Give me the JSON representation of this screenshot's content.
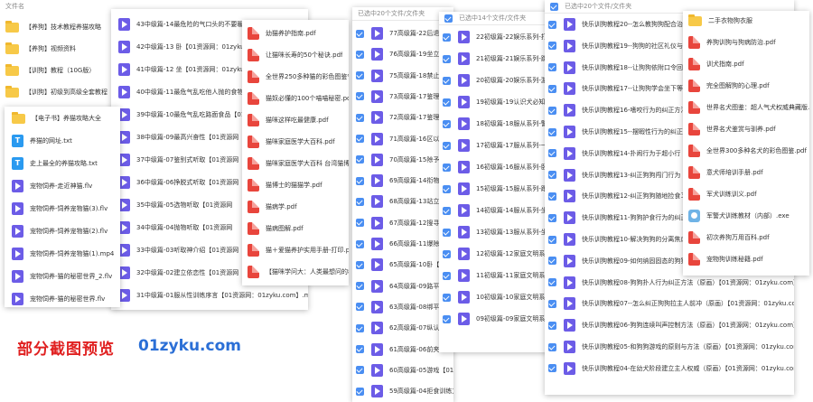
{
  "p1": {
    "header": "文件名",
    "items": [
      {
        "icon": "folder",
        "label": "【养狗】技术教程养猫攻略"
      },
      {
        "icon": "folder",
        "label": "【养狗】视频资料"
      },
      {
        "icon": "folder",
        "label": "【训狗】教程（10G版）"
      },
      {
        "icon": "folder",
        "label": "【训狗】初级到高级全套教程"
      }
    ]
  },
  "p2": {
    "items": [
      {
        "icon": "folder",
        "label": "【电子书】养猫攻略大全"
      },
      {
        "icon": "txt",
        "label": "养猫的网址.txt"
      },
      {
        "icon": "txt",
        "label": "史上最全的养猫攻略.txt"
      },
      {
        "icon": "video",
        "label": "宠物饲养-走近神猫.flv"
      },
      {
        "icon": "video",
        "label": "宠物饲养-饲养宠物猫(3).flv"
      },
      {
        "icon": "video",
        "label": "宠物饲养-饲养宠物猫(2).flv"
      },
      {
        "icon": "video",
        "label": "宠物饲养-饲养宠物猫(1).mp4"
      },
      {
        "icon": "video",
        "label": "宠物饲养-猫的秘密世界_2.flv"
      },
      {
        "icon": "video",
        "label": "宠物饲养-猫的秘密世界.flv"
      }
    ]
  },
  "p3": {
    "items": [
      {
        "icon": "video",
        "label": "43中级篇-14最危险的气口头的不要暖喂养视频"
      },
      {
        "icon": "video",
        "label": "42中级篇-13 卧【01资源网：01zyku.com】"
      },
      {
        "icon": "video",
        "label": "41中级篇-12 坐【01资源网：01zyku.com】"
      },
      {
        "icon": "video",
        "label": "40中级篇-11最危气乱吃他人抛的食物的"
      },
      {
        "icon": "video",
        "label": "39中级篇-10最危气乱吃路面食品【01资"
      },
      {
        "icon": "video",
        "label": "38中级篇-09最高兴奋性【01资源网"
      },
      {
        "icon": "video",
        "label": "37中级篇-07鉴别式听取【01资源网"
      },
      {
        "icon": "video",
        "label": "36中级篇-06挣脱式听取【01资源网"
      },
      {
        "icon": "video",
        "label": "35中级篇-05选物听取【01资源网"
      },
      {
        "icon": "video",
        "label": "34中级篇-04抛物听取【01资源网"
      },
      {
        "icon": "video",
        "label": "33中级篇-03听取神介绍【01资源网"
      },
      {
        "icon": "video",
        "label": "32中级篇-02建立依恋性【01资源网"
      },
      {
        "icon": "video",
        "label": "31中级篇-01服从性训练序言【01资源网：01zyku.com】.mpg"
      }
    ]
  },
  "p4": {
    "items": [
      {
        "icon": "pdf",
        "label": "幼猫养护指南.pdf"
      },
      {
        "icon": "pdf",
        "label": "让猫咪长寿的50个秘诀.pdf"
      },
      {
        "icon": "pdf",
        "label": "全世界250多种猫的彩色图鉴%50"
      },
      {
        "icon": "pdf",
        "label": "猫奴必懂的100个喵喵秘密.pdf"
      },
      {
        "icon": "pdf",
        "label": "猫咪这样吃最健康.pdf"
      },
      {
        "icon": "pdf",
        "label": "猫咪家庭医学大百科.pdf"
      },
      {
        "icon": "pdf",
        "label": "猫咪家庭医学大百科 台湾猫博士"
      },
      {
        "icon": "pdf",
        "label": "猫博士的猫猫学.pdf"
      },
      {
        "icon": "pdf",
        "label": "猫病学.pdf"
      },
      {
        "icon": "pdf",
        "label": "猫病图解.pdf"
      },
      {
        "icon": "pdf",
        "label": "猫＋爱猫养护实用手册-打印.pdf"
      },
      {
        "icon": "pdf",
        "label": "【猫咪学问大：人类最想问的80个"
      }
    ]
  },
  "p5": {
    "header": "已选中20个文件/文件夹",
    "items": [
      {
        "label": "77高级篇-22后退【01资"
      },
      {
        "label": "76高级篇-19坐立【01资"
      },
      {
        "label": "75高级篇-18禁止【01资"
      },
      {
        "label": "73高级篇-17鉴理性【01"
      },
      {
        "label": "72高级篇-17鉴理性训练"
      },
      {
        "label": "71高级篇-16区以与养"
      },
      {
        "label": "70高级篇-15除予持物"
      },
      {
        "label": "69高级篇-14衔物【01资"
      },
      {
        "label": "68高级篇-13站立【01资"
      },
      {
        "label": "67高级篇-12搜寻方向"
      },
      {
        "label": "66高级篇-11爆除面目"
      },
      {
        "label": "65高级篇-10卧【01资源网"
      },
      {
        "label": "64高级篇-09路平面的"
      },
      {
        "label": "63高级篇-08绑平面性"
      },
      {
        "label": "62高级篇-07纵认搜物"
      },
      {
        "label": "61高级篇-06前夹【01资源网：01zyku.com】.mpg"
      },
      {
        "label": "60高级篇-05游戏【01资源网：01zyku.com】.mpg"
      },
      {
        "label": "59高级篇-04拒食训练方法【01资源网：01zyku.com】.mpg"
      }
    ]
  },
  "p6": {
    "header": "已选中14个文件/文件夹",
    "items": [
      {
        "label": "22初级篇-22娱乐系列-打转"
      },
      {
        "label": "21初级篇-21娱乐系列-跳绳"
      },
      {
        "label": "20初级篇-20娱乐系列-游泳"
      },
      {
        "label": "19初级篇-19认识犬必知"
      },
      {
        "label": "18初级篇-18服从系列-警告"
      },
      {
        "label": "17初级篇-17服从系列-一招"
      },
      {
        "label": "16初级篇-16服从系列-卧在"
      },
      {
        "label": "15初级篇-15服从系列-跟随"
      },
      {
        "label": "14初级篇-14服从系列-坐在"
      },
      {
        "label": "13初级篇-13服从系列-坐"
      },
      {
        "label": "12初级篇-12家庭文明系列"
      },
      {
        "label": "11初级篇-11家庭文明系列"
      },
      {
        "label": "10初级篇-10家庭文明系列"
      },
      {
        "label": "09初级篇-09家庭文明系列"
      }
    ]
  },
  "p7": {
    "header": "已选中20个文件/文件夹",
    "items": [
      {
        "label": "快乐训狗教程20--怎么教狗狗配合治疗"
      },
      {
        "label": "快乐训狗教程19--狗狗的社区礼仪与最佳"
      },
      {
        "label": "快乐训狗教程18--让狗狗依附口令回到窝"
      },
      {
        "label": "快乐训狗教程17--让狗狗学会坐下等待"
      },
      {
        "label": "快乐训狗教程16-嗜咬行为的纠正方法"
      },
      {
        "label": "快乐训狗教程15--摆暇性行为的纠正方法"
      },
      {
        "label": "快乐训狗教程14-扑闹行为于超小行"
      },
      {
        "label": "快乐训狗教程13-纠正狗狗闯门行为"
      },
      {
        "label": "快乐训狗教程12-纠正狗狗随地捡食习惯"
      },
      {
        "label": "快乐训狗教程11-狗狗护食行为的纠正"
      },
      {
        "label": "快乐训狗教程10-解决狗狗的分离焦虑"
      },
      {
        "label": "快乐训狗教程09-如何纳固固态的狗狗"
      },
      {
        "label": "快乐训狗教程08-狗狗扑人行为纠正方法（原画）【01资源网：01zyku.com】.m"
      },
      {
        "label": "快乐训狗教程07--怎么纠正狗狗拉主人前冲（原画）【01资源网：01zyku.com】.m"
      },
      {
        "label": "快乐训狗教程06-狗狗连续叫声控制方法（原画）【01资源网：01zyku.com】.m"
      },
      {
        "label": "快乐训狗教程05-和狗狗游戏的原则与方法（原画）【01资源网：01zyku.com】.m"
      },
      {
        "label": "快乐训狗教程04-在幼犬阶段建立主人权威（原画）【01资源网：01zyku.com】.m"
      }
    ]
  },
  "p8": {
    "items": [
      {
        "icon": "folder",
        "label": "二手衣物狗衣服"
      },
      {
        "icon": "pdf",
        "label": "养狗训狗与狗病防治.pdf"
      },
      {
        "icon": "pdf",
        "label": "训犬指南.pdf"
      },
      {
        "icon": "pdf",
        "label": "完全图解狗的心理.pdf"
      },
      {
        "icon": "pdf",
        "label": "世界名犬图鉴：超人气犬权威典藏版.pdf"
      },
      {
        "icon": "pdf",
        "label": "世界名犬鉴赏与驯养.pdf"
      },
      {
        "icon": "pdf",
        "label": "全世界300多种名犬的彩色图鉴.pdf"
      },
      {
        "icon": "pdf",
        "label": "意犬师培训手册.pdf"
      },
      {
        "icon": "pdf",
        "label": "军犬训练训义.pdf"
      },
      {
        "icon": "exe",
        "label": "军警犬训练教材（内部）.exe"
      },
      {
        "icon": "pdf",
        "label": "初次养狗万用百科.pdf"
      },
      {
        "icon": "pdf",
        "label": "宠物狗训练秘籍.pdf"
      }
    ]
  },
  "footer": {
    "preview_label": "部分截图预览",
    "site": "01zyku.com"
  },
  "colors": {
    "accent": "#4a8ef2",
    "video": "#6c5ce7",
    "pdf": "#e8453c",
    "folder": "#f7c948",
    "promo_red": "#e02020",
    "promo_blue": "#2b6fd6"
  }
}
